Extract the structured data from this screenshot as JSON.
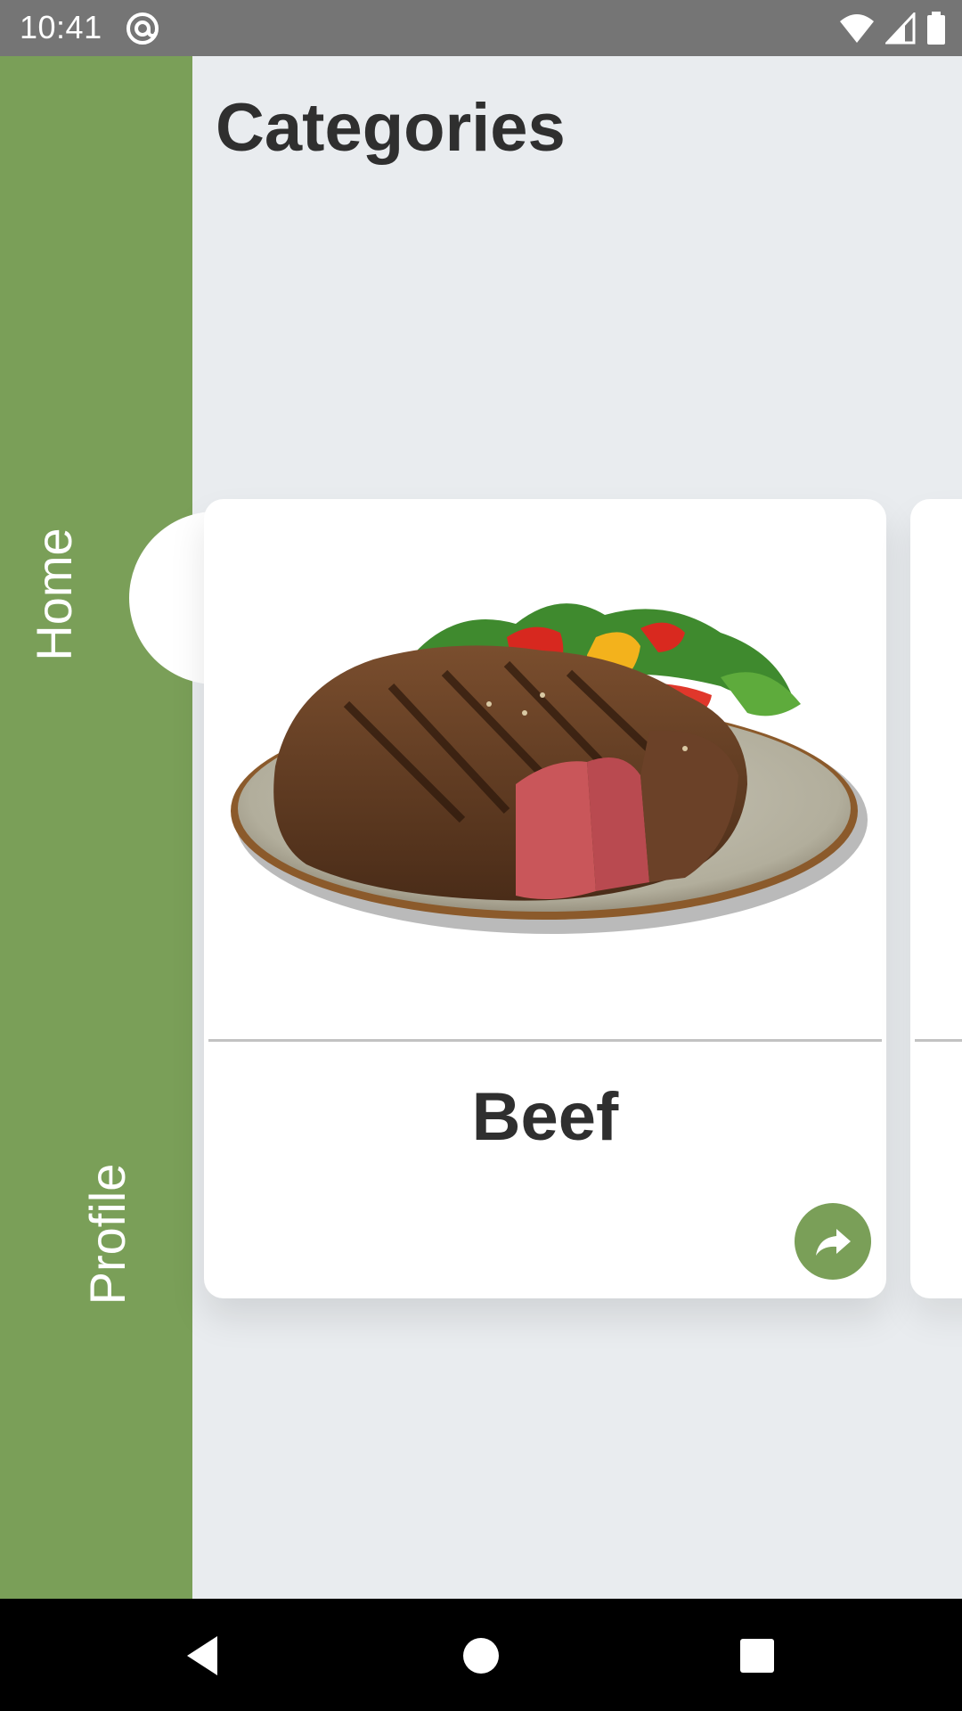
{
  "status_bar": {
    "time": "10:41",
    "icons": [
      "at-sign-icon",
      "wifi-icon",
      "cellular-signal-icon",
      "battery-icon"
    ]
  },
  "sidebar": {
    "color": "#7a9f58",
    "tabs": [
      {
        "label": "Home",
        "selected": true
      },
      {
        "label": "Profile",
        "selected": false
      }
    ]
  },
  "main": {
    "title": "Categories",
    "cards": [
      {
        "name": "Beef",
        "image": "grilled-steak-with-vegetables",
        "action_icon": "share-arrow-icon"
      }
    ]
  },
  "nav_bar": {
    "buttons": [
      "back-icon",
      "home-icon",
      "recents-icon"
    ]
  }
}
